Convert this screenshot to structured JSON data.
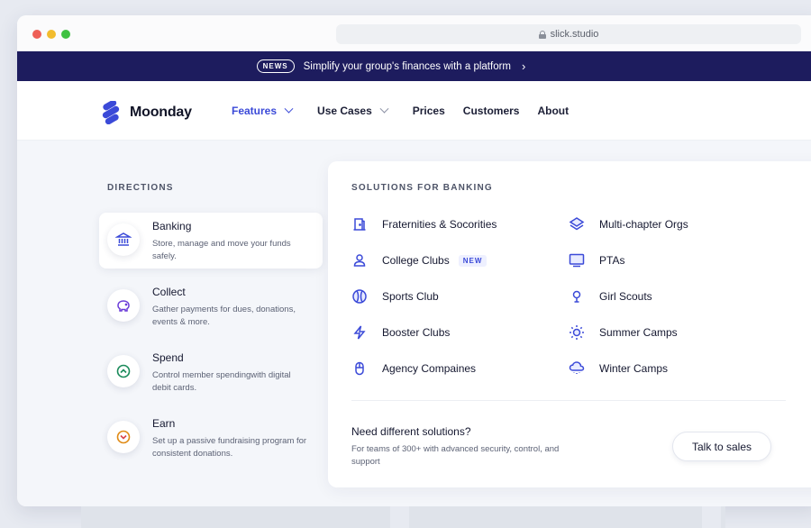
{
  "browser": {
    "url": "slick.studio"
  },
  "banner": {
    "badge": "NEWS",
    "text": "Simplify your group's finances with a platform",
    "chevron": "›"
  },
  "nav": {
    "logo": "Moonday",
    "items": [
      {
        "label": "Features",
        "dropdown": true,
        "active": true
      },
      {
        "label": "Use Cases",
        "dropdown": true
      },
      {
        "label": "Prices"
      },
      {
        "label": "Customers"
      },
      {
        "label": "About"
      }
    ]
  },
  "directions": {
    "title": "DIRECTIONS",
    "items": [
      {
        "name": "Banking",
        "desc": "Store, manage and  move your funds safely.",
        "icon": "bank-icon"
      },
      {
        "name": "Collect",
        "desc": "Gather payments for dues, donations, events & more.",
        "icon": "piggy-bank-icon"
      },
      {
        "name": "Spend",
        "desc": "Control member spendingwith digital debit cards.",
        "icon": "arrow-up-circle-icon"
      },
      {
        "name": "Earn",
        "desc": "Set up a passive fundraising program for consistent donations.",
        "icon": "arrow-down-circle-icon"
      }
    ]
  },
  "solutions": {
    "title": "SOLUTIONS FOR BANKING",
    "left": [
      {
        "label": "Fraternities & Socorities",
        "icon": "door-icon"
      },
      {
        "label": "College Clubs",
        "icon": "user-icon",
        "badge": "NEW"
      },
      {
        "label": "Sports Club",
        "icon": "ball-icon"
      },
      {
        "label": "Booster Clubs",
        "icon": "lightning-icon"
      },
      {
        "label": "Agency Compaines",
        "icon": "mouse-icon"
      }
    ],
    "right": [
      {
        "label": "Multi-chapter Orgs",
        "icon": "layers-icon"
      },
      {
        "label": "PTAs",
        "icon": "monitor-icon"
      },
      {
        "label": "Girl Scouts",
        "icon": "location-pin-icon"
      },
      {
        "label": "Summer Camps",
        "icon": "sun-icon"
      },
      {
        "label": "Winter Camps",
        "icon": "snow-cloud-icon"
      }
    ],
    "footer": {
      "title": "Need different solutions?",
      "desc": "For teams of 300+ with advanced security, control, and support",
      "button": "Talk to sales"
    }
  },
  "colors": {
    "accent": "#3b4ad8",
    "banner": "#1d1c5e"
  }
}
